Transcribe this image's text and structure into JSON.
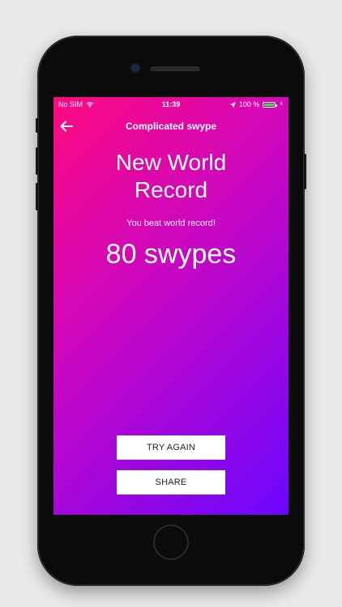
{
  "status_bar": {
    "carrier": "No SIM",
    "time": "11:39",
    "battery_percent": "100 %",
    "battery_level": 1.0,
    "icons": [
      "wifi-icon",
      "location-arrow-icon",
      "battery-icon",
      "charging-bolt-icon"
    ]
  },
  "nav": {
    "title": "Complicated swype",
    "back_icon": "arrow-left-icon"
  },
  "result": {
    "headline_line1": "New World",
    "headline_line2": "Record",
    "subtitle": "You beat world record!",
    "score": "80 swypes"
  },
  "buttons": {
    "try_again": "TRY AGAIN",
    "share": "SHARE"
  },
  "colors": {
    "gradient_start": "#ff0a80",
    "gradient_end": "#6b07ff",
    "battery_green": "#3cdc46"
  }
}
